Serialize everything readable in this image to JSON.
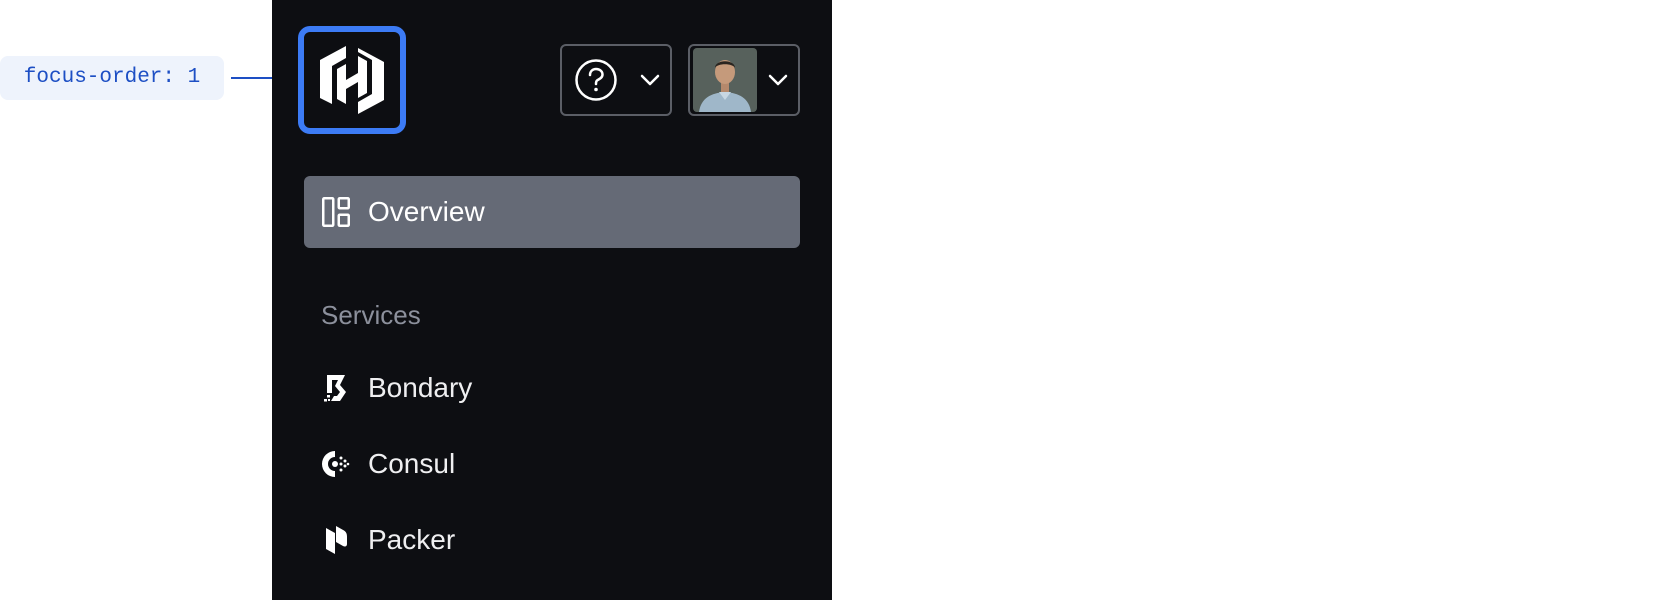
{
  "annotation": {
    "focus_label": "focus-order: 1",
    "color": "#1d4fc4"
  },
  "header": {
    "logo_icon": "hashicorp-logo-icon",
    "help_button_icon": "help-circle-icon",
    "user_avatar": "user-avatar"
  },
  "nav": {
    "overview_label": "Overview",
    "section_title": "Services",
    "items": [
      {
        "label": "Bondary",
        "icon": "boundary-icon"
      },
      {
        "label": "Consul",
        "icon": "consul-icon"
      },
      {
        "label": "Packer",
        "icon": "packer-icon"
      }
    ]
  },
  "colors": {
    "sidebar_bg": "#0d0e12",
    "focus_ring": "#3c7bf5",
    "active_item_bg": "#656a76",
    "section_text": "#8c909c"
  }
}
